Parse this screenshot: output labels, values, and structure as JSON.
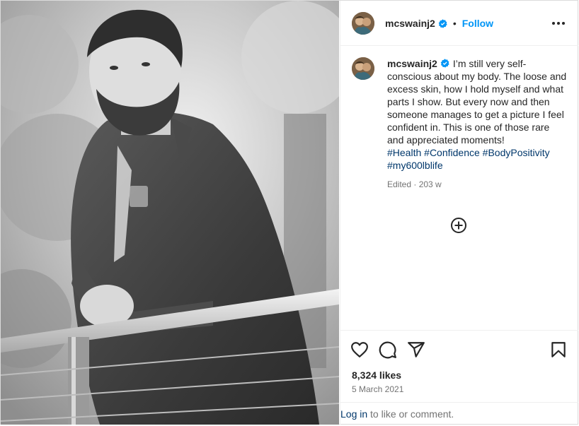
{
  "post": {
    "username": "mcswainj2",
    "follow_label": "Follow",
    "separator": "•",
    "verified": true,
    "caption": "I’m still very self-conscious about my body. The loose and excess skin, how I hold myself and what parts I show. But every now and then someone manages to get a picture I feel confident in. This is one of those rare and appreciated moments!",
    "hashtags": [
      "#Health",
      "#Confidence",
      "#BodyPositivity",
      "#my600lblife"
    ],
    "edited_label": "Edited · 203 w",
    "likes": "8,324 likes",
    "date": "5 March 2021"
  },
  "footer": {
    "login_link": "Log in",
    "login_text": " to like or comment."
  },
  "icons": {
    "verified": "verified-badge-icon",
    "more": "more-options-icon",
    "like": "heart-icon",
    "comment": "comment-icon",
    "share": "share-icon",
    "save": "bookmark-icon",
    "load_more": "plus-circle-icon"
  },
  "colors": {
    "accent": "#0095f6",
    "hashtag": "#00376b",
    "muted": "#737373"
  }
}
